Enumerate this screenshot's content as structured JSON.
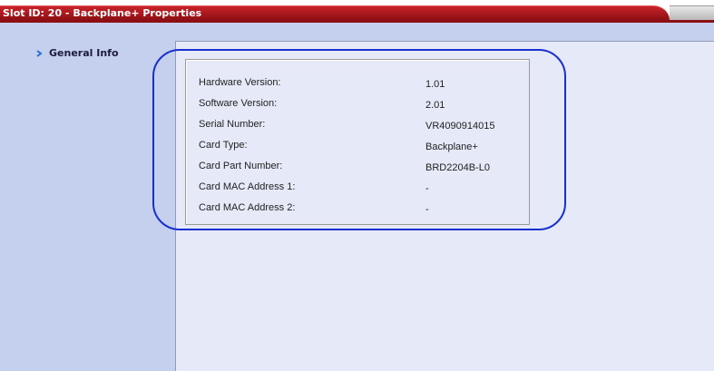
{
  "window": {
    "title": "Slot ID: 20 - Backplane+ Properties"
  },
  "sidebar": {
    "items": [
      {
        "label": "General Info",
        "icon": "chevron-right-icon"
      }
    ]
  },
  "properties": [
    {
      "label": "Hardware Version:",
      "value": "1.01"
    },
    {
      "label": "Software Version:",
      "value": "2.01"
    },
    {
      "label": "Serial Number:",
      "value": "VR4090914015"
    },
    {
      "label": "Card Type:",
      "value": "Backplane+"
    },
    {
      "label": "Card Part Number:",
      "value": "BRD2204B-L0"
    },
    {
      "label": "Card MAC Address 1:",
      "value": "-"
    },
    {
      "label": "Card MAC Address 2:",
      "value": "-"
    }
  ],
  "colors": {
    "title_bar": "#b3191e",
    "sidebar_bg": "#c4d0ee",
    "content_bg": "#e6eaf8",
    "highlight": "#1a2fd0"
  }
}
